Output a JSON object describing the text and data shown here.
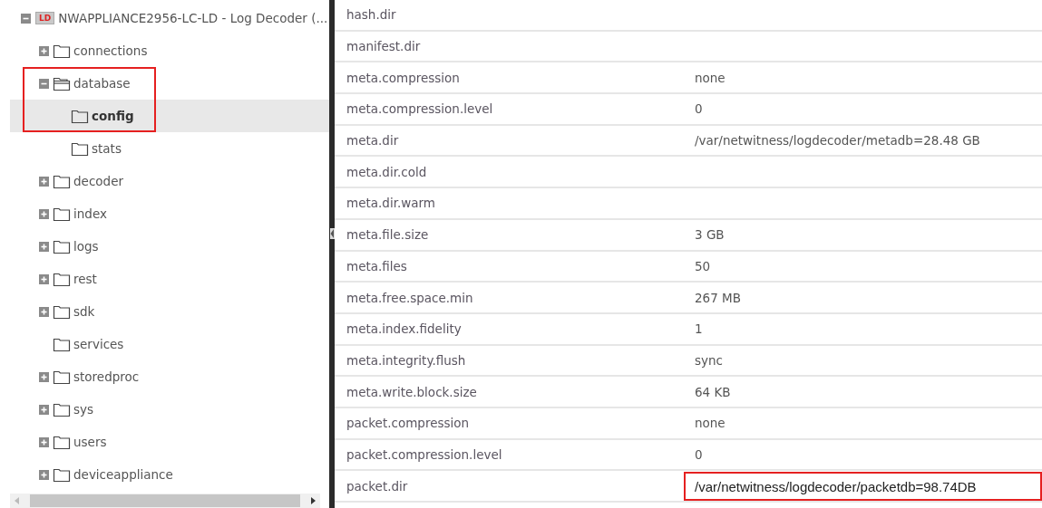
{
  "tree": {
    "label": "NWAPPLIANCE2956-LC-LD - Log Decoder (...",
    "badge": "LD",
    "expanded": true,
    "selected": false,
    "highlighted": false,
    "children": [
      {
        "label": "connections",
        "expanded": false,
        "selected": false,
        "highlighted": false
      },
      {
        "label": "database",
        "expanded": true,
        "selected": false,
        "highlighted": true,
        "children": [
          {
            "label": "config",
            "selected": true,
            "highlighted": false
          },
          {
            "label": "stats",
            "selected": false,
            "highlighted": false
          }
        ]
      },
      {
        "label": "decoder",
        "expanded": false,
        "selected": false,
        "highlighted": false
      },
      {
        "label": "index",
        "expanded": false,
        "selected": false,
        "highlighted": false
      },
      {
        "label": "logs",
        "expanded": false,
        "selected": false,
        "highlighted": false
      },
      {
        "label": "rest",
        "expanded": false,
        "selected": false,
        "highlighted": false
      },
      {
        "label": "sdk",
        "expanded": false,
        "selected": false,
        "highlighted": false
      },
      {
        "label": "services",
        "selected": false,
        "highlighted": false
      },
      {
        "label": "storedproc",
        "expanded": false,
        "selected": false,
        "highlighted": false
      },
      {
        "label": "sys",
        "expanded": false,
        "selected": false,
        "highlighted": false
      },
      {
        "label": "users",
        "expanded": false,
        "selected": false,
        "highlighted": false
      },
      {
        "label": "deviceappliance",
        "expanded": false,
        "selected": false,
        "highlighted": false
      }
    ]
  },
  "table": {
    "rows": [
      {
        "key": "hash.dir",
        "highlighted": false
      },
      {
        "key": "manifest.dir",
        "highlighted": false
      },
      {
        "key": "meta.compression",
        "value": "none",
        "highlighted": false
      },
      {
        "key": "meta.compression.level",
        "value": "0",
        "highlighted": false
      },
      {
        "key": "meta.dir",
        "value": "/var/netwitness/logdecoder/metadb=28.48 GB",
        "highlighted": false
      },
      {
        "key": "meta.dir.cold",
        "highlighted": false
      },
      {
        "key": "meta.dir.warm",
        "highlighted": false
      },
      {
        "key": "meta.file.size",
        "value": "3 GB",
        "highlighted": false
      },
      {
        "key": "meta.files",
        "value": "50",
        "highlighted": false
      },
      {
        "key": "meta.free.space.min",
        "value": "267 MB",
        "highlighted": false
      },
      {
        "key": "meta.index.fidelity",
        "value": "1",
        "highlighted": false
      },
      {
        "key": "meta.integrity.flush",
        "value": "sync",
        "highlighted": false
      },
      {
        "key": "meta.write.block.size",
        "value": "64 KB",
        "highlighted": false
      },
      {
        "key": "packet.compression",
        "value": "none",
        "highlighted": false
      },
      {
        "key": "packet.compression.level",
        "value": "0",
        "highlighted": false
      },
      {
        "key": "packet.dir",
        "value": "/var/netwitness/logdecoder/packetdb=98.74DB",
        "highlighted": true
      }
    ]
  }
}
